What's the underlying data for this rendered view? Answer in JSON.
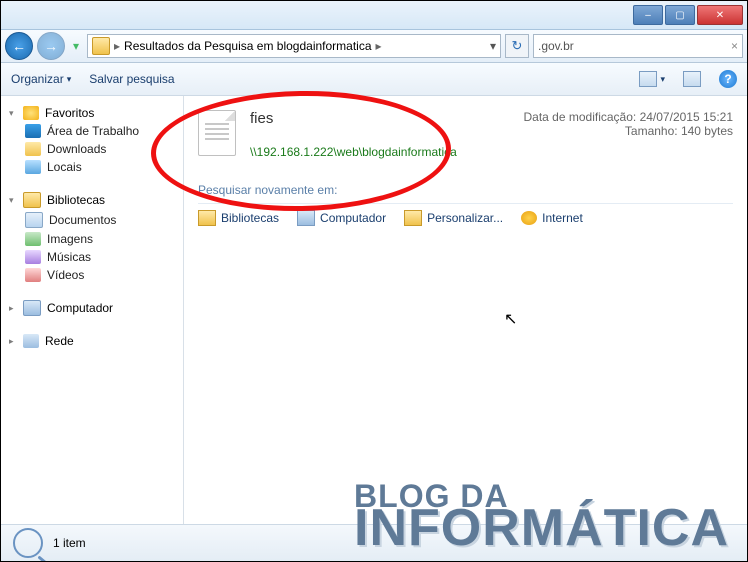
{
  "titlebar": {
    "min": "–",
    "max": "▢",
    "close": "✕"
  },
  "nav": {
    "back": "←",
    "forward": "→",
    "dropdown": "▾",
    "breadcrumb_label": "Resultados da Pesquisa em blogdainformatica",
    "sep": "▸",
    "refresh": "↻",
    "search_value": ".gov.br",
    "search_x": "×"
  },
  "toolbar": {
    "organize": "Organizar",
    "save_search": "Salvar pesquisa",
    "drop": "▾",
    "help": "?"
  },
  "sidebar": {
    "favorites": {
      "label": "Favoritos",
      "items": [
        "Área de Trabalho",
        "Downloads",
        "Locais"
      ]
    },
    "libraries": {
      "label": "Bibliotecas",
      "items": [
        "Documentos",
        "Imagens",
        "Músicas",
        "Vídeos"
      ]
    },
    "computer": {
      "label": "Computador"
    },
    "network": {
      "label": "Rede"
    }
  },
  "result": {
    "title": "fies",
    "path": "\\\\192.168.1.222\\web\\blogdainformatica",
    "mod_label": "Data de modificação:",
    "mod_value": "24/07/2015 15:21",
    "size_label": "Tamanho:",
    "size_value": "140 bytes"
  },
  "search_again": {
    "label": "Pesquisar novamente em:",
    "items": [
      "Bibliotecas",
      "Computador",
      "Personalizar...",
      "Internet"
    ]
  },
  "status": {
    "count": "1 item"
  },
  "watermark": {
    "l1": "BLOG DA",
    "l2": "INFORMÁTICA"
  }
}
